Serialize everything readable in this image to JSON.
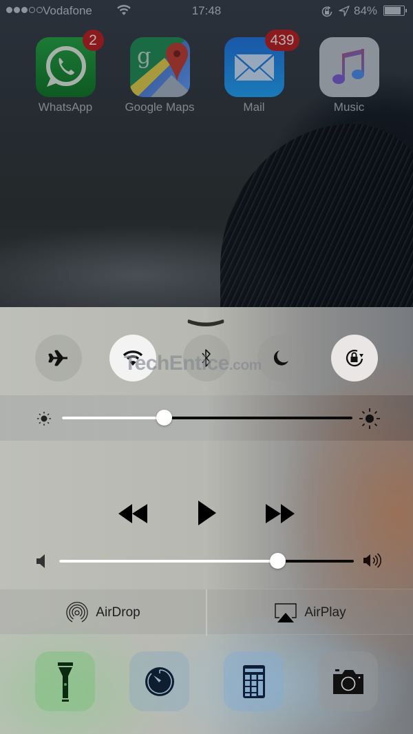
{
  "status_bar": {
    "signal_bars_filled": 3,
    "signal_bars_total": 5,
    "carrier": "Vodafone",
    "time": "17:48",
    "battery_percent_label": "84%",
    "battery_level": 0.84,
    "icons": [
      "wifi-icon",
      "rotation-lock-icon",
      "location-icon",
      "battery-icon"
    ]
  },
  "home_apps": [
    {
      "label": "WhatsApp",
      "badge": "2",
      "icon": "whatsapp-icon"
    },
    {
      "label": "Google Maps",
      "badge": null,
      "icon": "google-maps-icon"
    },
    {
      "label": "Mail",
      "badge": "439",
      "icon": "mail-icon"
    },
    {
      "label": "Music",
      "badge": null,
      "icon": "music-icon"
    }
  ],
  "control_center": {
    "grabber_icon": "chevron-down-icon",
    "toggles": [
      {
        "name": "airplane-mode",
        "icon": "airplane-icon",
        "on": false
      },
      {
        "name": "wifi",
        "icon": "wifi-icon",
        "on": true
      },
      {
        "name": "bluetooth",
        "icon": "bluetooth-icon",
        "on": false
      },
      {
        "name": "do-not-disturb",
        "icon": "moon-icon",
        "on": false
      },
      {
        "name": "rotation-lock",
        "icon": "rotation-lock-icon",
        "on": true
      }
    ],
    "watermark": {
      "brand": "TechEntice",
      "suffix": ".com"
    },
    "brightness": {
      "level": 0.35
    },
    "media": {
      "buttons": [
        "rewind-icon",
        "play-icon",
        "fast-forward-icon"
      ]
    },
    "volume": {
      "level": 0.74
    },
    "airdrop": {
      "label": "AirDrop"
    },
    "airplay": {
      "label": "AirPlay"
    },
    "shortcuts": [
      {
        "name": "flashlight",
        "icon": "flashlight-icon"
      },
      {
        "name": "timer",
        "icon": "timer-icon"
      },
      {
        "name": "calculator",
        "icon": "calculator-icon"
      },
      {
        "name": "camera",
        "icon": "camera-icon"
      }
    ]
  }
}
